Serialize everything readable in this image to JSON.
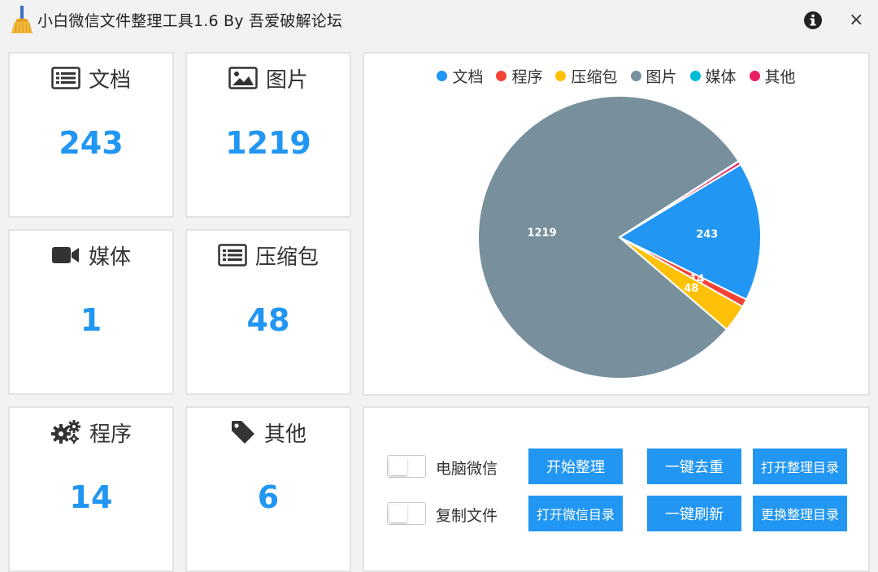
{
  "window": {
    "title": "小白微信文件整理工具1.6 By 吾爱破解论坛",
    "close_glyph": "×"
  },
  "stats": [
    {
      "key": "docs",
      "label": "文档",
      "value": "243",
      "icon": "document-list-icon"
    },
    {
      "key": "images",
      "label": "图片",
      "value": "1219",
      "icon": "image-icon"
    },
    {
      "key": "media",
      "label": "媒体",
      "value": "1",
      "icon": "video-camera-icon"
    },
    {
      "key": "archive",
      "label": "压缩包",
      "value": "48",
      "icon": "archive-list-icon"
    },
    {
      "key": "programs",
      "label": "程序",
      "value": "14",
      "icon": "gears-icon"
    },
    {
      "key": "other",
      "label": "其他",
      "value": "6",
      "icon": "tag-icon"
    }
  ],
  "chart_data": {
    "type": "pie",
    "categories": [
      "文档",
      "程序",
      "压缩包",
      "图片",
      "媒体",
      "其他"
    ],
    "values": [
      243,
      14,
      48,
      1219,
      1,
      6
    ],
    "colors": [
      "#2196f3",
      "#f44336",
      "#ffc107",
      "#78909c",
      "#00bcd4",
      "#e91e63"
    ],
    "data_labels": [
      "243",
      "14",
      "48",
      "1219",
      "",
      ""
    ],
    "legend": "top-center",
    "start_angle_deg": 59
  },
  "controls": {
    "options": [
      {
        "label": "电脑微信",
        "checked": false
      },
      {
        "label": "复制文件",
        "checked": false
      }
    ],
    "buttons": {
      "start": "开始整理",
      "dedupe": "一键去重",
      "open_output": "打开整理目录",
      "open_wechat": "打开微信目录",
      "refresh": "一键刷新",
      "change_output": "更换整理目录"
    }
  }
}
